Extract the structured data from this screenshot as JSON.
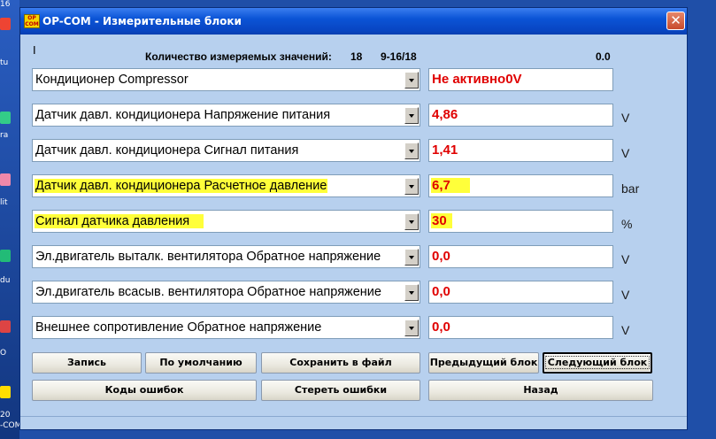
{
  "desktop": {
    "labels": [
      "16",
      "tu",
      "ra",
      "lit",
      "du",
      "O",
      "20",
      "-COM"
    ]
  },
  "window": {
    "title": "OP-COM - Измерительные блоки",
    "icon_text": [
      "OP",
      "COM"
    ],
    "close_glyph": "✕",
    "cursor": "I"
  },
  "header": {
    "count_label": "Количество измеряемых значений:",
    "count_value": "18",
    "range": "9-16/18",
    "time_value": "0.0"
  },
  "rows": [
    {
      "name": "Кондиционер Compressor",
      "value": "Не активно0V",
      "unit": "",
      "highlight_name": false,
      "highlight_value": false
    },
    {
      "name": "Датчик давл. кондиционера Напряжение питания",
      "value": "4,86",
      "unit": "V",
      "highlight_name": false,
      "highlight_value": false
    },
    {
      "name": "Датчик давл. кондиционера  Сигнал питания",
      "value": "1,41",
      "unit": "V",
      "highlight_name": false,
      "highlight_value": false
    },
    {
      "name": "Датчик давл. кондиционера  Расчетное давление",
      "value": "6,7",
      "unit": "bar",
      "highlight_name": true,
      "highlight_value": true
    },
    {
      "name": "Сигнал датчика давления",
      "value": "30",
      "unit": "%",
      "highlight_name": true,
      "highlight_value": true
    },
    {
      "name": "Эл.двигатель выталк. вентилятора  Обратное напряжение",
      "value": "0,0",
      "unit": "V",
      "highlight_name": false,
      "highlight_value": false
    },
    {
      "name": "Эл.двигатель всасыв. вентилятора  Обратное напряжение",
      "value": "0,0",
      "unit": "V",
      "highlight_name": false,
      "highlight_value": false
    },
    {
      "name": "Внешнее сопротивление   Обратное напряжение",
      "value": "0,0",
      "unit": "V",
      "highlight_name": false,
      "highlight_value": false
    }
  ],
  "buttons": {
    "record": "Запись",
    "default": "По умолчанию",
    "save_file": "Сохранить в файл",
    "prev_block": "Предыдущий блок",
    "next_block": "Следующий блок",
    "error_codes": "Коды ошибок",
    "clear_errors": "Стереть ошибки",
    "back": "Назад"
  },
  "colors": {
    "window_bg": "#b7d0ee",
    "value_text": "#e00000",
    "highlight": "#ffff3a",
    "titlebar": "#0b54d6"
  }
}
